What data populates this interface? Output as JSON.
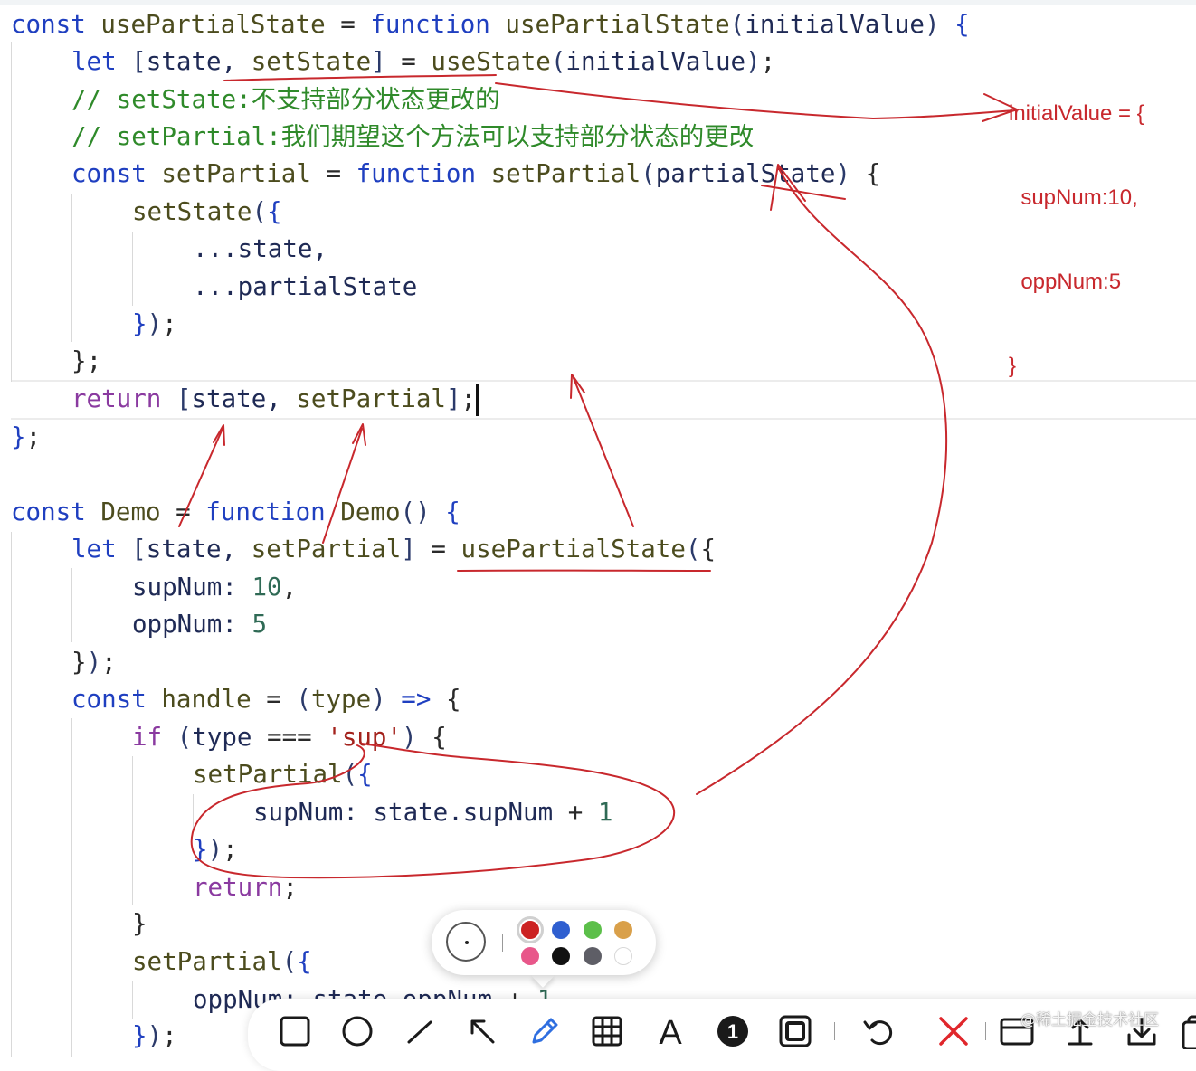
{
  "code_lines": [
    [
      [
        "kw",
        "const "
      ],
      [
        "fn",
        "usePartialState "
      ],
      [
        "plain",
        "= "
      ],
      [
        "kw",
        "function "
      ],
      [
        "fn",
        "usePartialState"
      ],
      [
        "bracket",
        "("
      ],
      [
        "var",
        "initialValue"
      ],
      [
        "bracket",
        ") "
      ],
      [
        "bluebrace",
        "{"
      ]
    ],
    [
      [
        "kw",
        "let "
      ],
      [
        "bracket",
        "["
      ],
      [
        "var",
        "state, "
      ],
      [
        "fn",
        "setState"
      ],
      [
        "bracket",
        "] "
      ],
      [
        "plain",
        "= "
      ],
      [
        "fn",
        "useState"
      ],
      [
        "bracket",
        "("
      ],
      [
        "var",
        "initialValue"
      ],
      [
        "bracket",
        ")"
      ],
      [
        "plain",
        ";"
      ]
    ],
    [
      [
        "comment",
        "// setState:不支持部分状态更改的"
      ]
    ],
    [
      [
        "comment",
        "// setPartial:我们期望这个方法可以支持部分状态的更改"
      ]
    ],
    [
      [
        "kw",
        "const "
      ],
      [
        "fn",
        "setPartial "
      ],
      [
        "plain",
        "= "
      ],
      [
        "kw",
        "function "
      ],
      [
        "fn",
        "setPartial"
      ],
      [
        "bracket",
        "("
      ],
      [
        "var",
        "partialState"
      ],
      [
        "bracket",
        ") "
      ],
      [
        "brace",
        "{"
      ]
    ],
    [
      [
        "fn",
        "setState"
      ],
      [
        "bracket",
        "("
      ],
      [
        "bluebrace",
        "{"
      ]
    ],
    [
      [
        "var",
        "...state,"
      ]
    ],
    [
      [
        "var",
        "...partialState"
      ]
    ],
    [
      [
        "bluebrace",
        "}"
      ],
      [
        "bracket",
        ")"
      ],
      [
        "plain",
        ";"
      ]
    ],
    [
      [
        "brace",
        "}"
      ],
      [
        "plain",
        ";"
      ]
    ],
    [
      [
        "purple",
        "return "
      ],
      [
        "bracket",
        "["
      ],
      [
        "var",
        "state, "
      ],
      [
        "fn",
        "setPartial"
      ],
      [
        "bracket",
        "]"
      ],
      [
        "plain",
        ";"
      ]
    ],
    [
      [
        "bluebrace",
        "}"
      ],
      [
        "plain",
        ";"
      ]
    ],
    [
      [
        "kw",
        "const "
      ],
      [
        "fn",
        "Demo "
      ],
      [
        "plain",
        "= "
      ],
      [
        "kw",
        "function "
      ],
      [
        "fn",
        "Demo"
      ],
      [
        "bracket",
        "() "
      ],
      [
        "bluebrace",
        "{"
      ]
    ],
    [
      [
        "kw",
        "let "
      ],
      [
        "bracket",
        "["
      ],
      [
        "var",
        "state, "
      ],
      [
        "fn",
        "setPartial"
      ],
      [
        "bracket",
        "] "
      ],
      [
        "plain",
        "= "
      ],
      [
        "fn",
        "usePartialState"
      ],
      [
        "bracket",
        "("
      ],
      [
        "brace",
        "{"
      ]
    ],
    [
      [
        "var",
        "supNum: "
      ],
      [
        "num",
        "10"
      ],
      [
        "plain",
        ","
      ]
    ],
    [
      [
        "var",
        "oppNum: "
      ],
      [
        "num",
        "5"
      ]
    ],
    [
      [
        "brace",
        "}"
      ],
      [
        "bracket",
        ")"
      ],
      [
        "plain",
        ";"
      ]
    ],
    [
      [
        "kw",
        "const "
      ],
      [
        "fn",
        "handle "
      ],
      [
        "plain",
        "= "
      ],
      [
        "bracket",
        "("
      ],
      [
        "fn",
        "type"
      ],
      [
        "bracket",
        ") "
      ],
      [
        "kw",
        "=> "
      ],
      [
        "brace",
        "{"
      ]
    ],
    [
      [
        "purple",
        "if "
      ],
      [
        "bracket",
        "("
      ],
      [
        "var",
        "type "
      ],
      [
        "plain",
        "=== "
      ],
      [
        "str",
        "'sup'"
      ],
      [
        "bracket",
        ") "
      ],
      [
        "brace",
        "{"
      ]
    ],
    [
      [
        "fn",
        "setPartial"
      ],
      [
        "bracket",
        "("
      ],
      [
        "bluebrace",
        "{"
      ]
    ],
    [
      [
        "var",
        "supNum: state.supNum "
      ],
      [
        "plain",
        "+ "
      ],
      [
        "num",
        "1"
      ]
    ],
    [
      [
        "bluebrace",
        "}"
      ],
      [
        "bracket",
        ")"
      ],
      [
        "plain",
        ";"
      ]
    ],
    [
      [
        "purple",
        "return"
      ],
      [
        "plain",
        ";"
      ]
    ],
    [
      [
        "brace",
        "}"
      ]
    ],
    [
      [
        "fn",
        "setPartial"
      ],
      [
        "bracket",
        "("
      ],
      [
        "bluebrace",
        "{"
      ]
    ],
    [
      [
        "var",
        "oppNum: state.oppNum "
      ],
      [
        "plain",
        "+ "
      ],
      [
        "num",
        "1"
      ]
    ],
    [
      [
        "bluebrace",
        "}"
      ],
      [
        "bracket",
        ")"
      ],
      [
        "plain",
        ";"
      ]
    ]
  ],
  "annotation": {
    "initial_value": [
      "initialValue = {",
      "  supNum:10,",
      "  oppNum:5",
      "}"
    ],
    "ink_color": "#c8282d"
  },
  "palette": {
    "brush_size_icon": "brush-size-icon",
    "colors": [
      "#cc2222",
      "#2f5fd0",
      "#5cbf4a",
      "#d9a04a",
      "#e8578a",
      "#111111",
      "#5e5e66",
      "#ffffff"
    ],
    "selected_index": 0
  },
  "toolbar": {
    "tools": [
      {
        "name": "rectangle-tool",
        "icon": "square-icon"
      },
      {
        "name": "ellipse-tool",
        "icon": "circle-icon"
      },
      {
        "name": "line-tool",
        "icon": "line-icon"
      },
      {
        "name": "arrow-tool",
        "icon": "arrow-icon"
      },
      {
        "name": "pen-tool",
        "icon": "pencil-icon",
        "active": true
      },
      {
        "name": "mosaic-tool",
        "icon": "grid-icon"
      },
      {
        "name": "text-tool",
        "icon": "text-icon",
        "label": "A"
      },
      {
        "name": "number-tool",
        "icon": "number-icon",
        "label": "1"
      },
      {
        "name": "frame-tool",
        "icon": "frame-icon"
      },
      {
        "name": "undo-button",
        "icon": "undo-icon"
      },
      {
        "name": "close-button",
        "icon": "close-icon"
      },
      {
        "name": "pin-button",
        "icon": "window-icon"
      },
      {
        "name": "upload-button",
        "icon": "upload-icon"
      },
      {
        "name": "save-button",
        "icon": "download-icon"
      },
      {
        "name": "copy-button",
        "icon": "copy-icon"
      }
    ],
    "active_color": "#2f6fe0"
  },
  "watermark": "@稀土掘金技术社区"
}
